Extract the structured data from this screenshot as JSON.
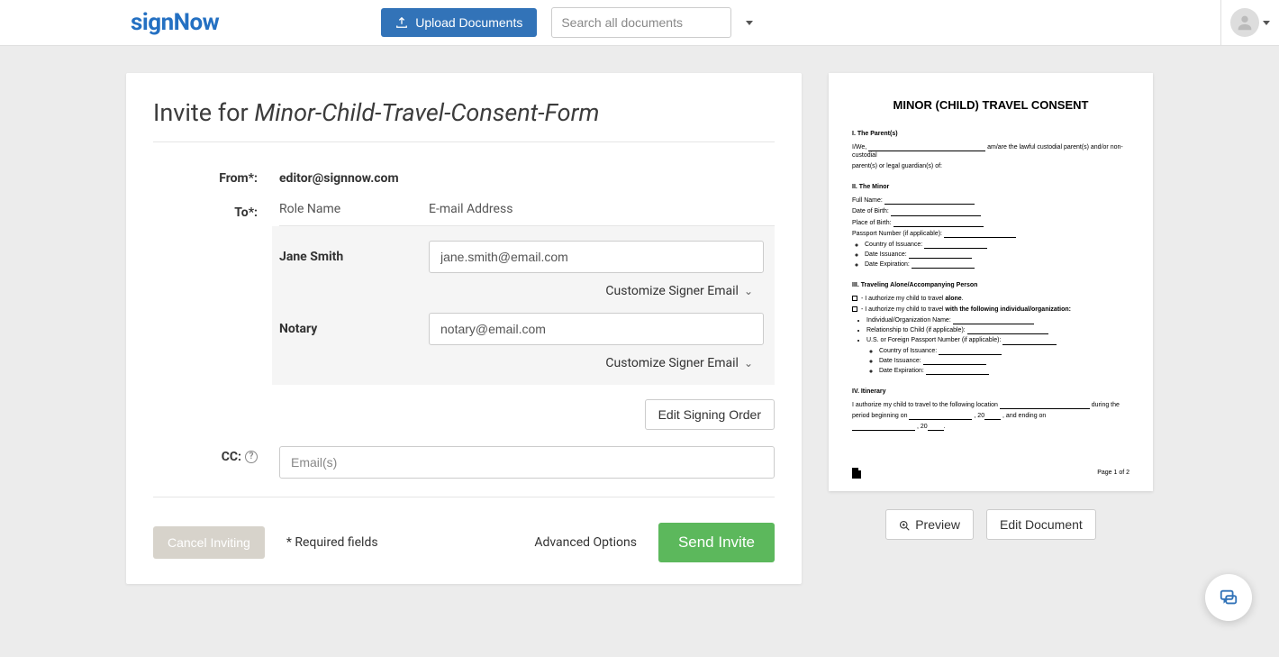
{
  "header": {
    "logo": "signNow",
    "upload_label": "Upload Documents",
    "search_placeholder": "Search all documents"
  },
  "invite": {
    "title_prefix": "Invite for ",
    "document_name": "Minor-Child-Travel-Consent-Form",
    "from_label": "From*:",
    "from_value": "editor@signnow.com",
    "to_label": "To*:",
    "role_header": "Role Name",
    "email_header": "E-mail Address",
    "recipients": [
      {
        "role": "Jane Smith",
        "email": "jane.smith@email.com"
      },
      {
        "role": "Notary",
        "email": "notary@email.com"
      }
    ],
    "customize_label": "Customize Signer Email",
    "edit_signing_order": "Edit Signing Order",
    "cc_label": "CC:",
    "cc_placeholder": "Email(s)",
    "cancel_label": "Cancel Inviting",
    "required_note": "* Required fields",
    "advanced_options": "Advanced Options",
    "send_label": "Send Invite"
  },
  "doc_preview": {
    "title": "MINOR (CHILD) TRAVEL CONSENT",
    "section1": "I. The Parent(s)",
    "line_iwe_prefix": "I/We,",
    "line_iwe_suffix": "am/are the lawful custodial parent(s) and/or non-custodial",
    "line_guardian": "parent(s) or legal guardian(s) of:",
    "section2": "II. The Minor",
    "full_name": "Full Name:",
    "dob": "Date of Birth:",
    "pob": "Place of Birth:",
    "passport": "Passport Number (if applicable):",
    "coi": "Country of Issuance:",
    "di": "Date Issuance:",
    "de": "Date Expiration:",
    "section3": "III. Traveling Alone/Accompanying Person",
    "auth_alone_prefix": "- I authorize my child to travel ",
    "auth_alone_bold": "alone",
    "auth_with_prefix": "- I authorize my child to travel ",
    "auth_with_bold": "with the following individual/organization:",
    "ind_org": "Individual/Organization Name:",
    "relationship": "Relationship to Child (if applicable):",
    "us_passport": "U.S. or Foreign Passport Number (if applicable):",
    "section4": "IV. Itinerary",
    "itinerary_prefix": "I authorize my child to travel to the following location",
    "itinerary_during": "during the",
    "itinerary_period": "period beginning on",
    "itinerary_ending": ", and ending on",
    "itinerary_twenty": ", 20",
    "page_label": "Page 1 of 2"
  },
  "preview_actions": {
    "preview": "Preview",
    "edit": "Edit Document"
  }
}
